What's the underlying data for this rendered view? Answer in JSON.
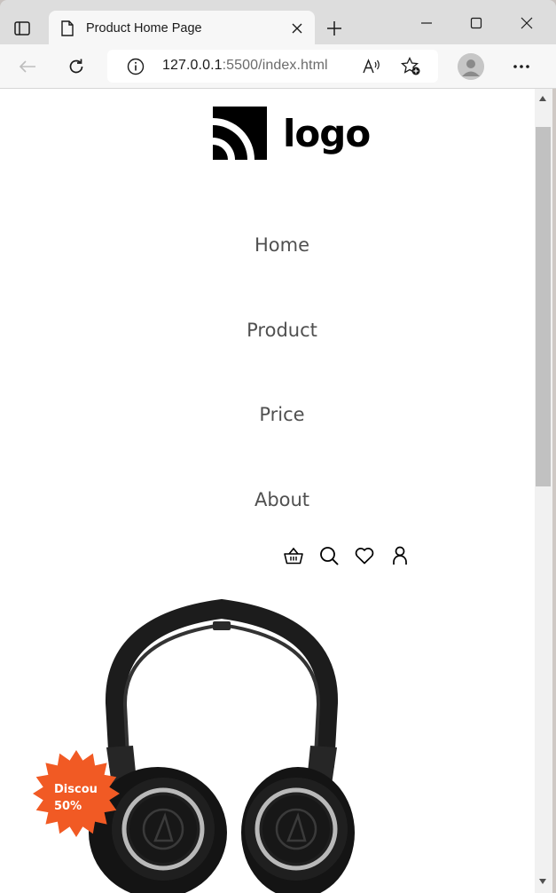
{
  "browser": {
    "tab_title": "Product Home Page",
    "url_host": "127.0.0.1",
    "url_rest": ":5500/index.html"
  },
  "site": {
    "logo_text": "logo",
    "nav": [
      "Home",
      "Product",
      "Price",
      "About"
    ],
    "header_icons": [
      "basket-icon",
      "search-icon",
      "heart-icon",
      "user-icon"
    ]
  },
  "hero": {
    "badge_line1": "Discou",
    "badge_line2": "50%",
    "badge_color": "#f15a24"
  }
}
